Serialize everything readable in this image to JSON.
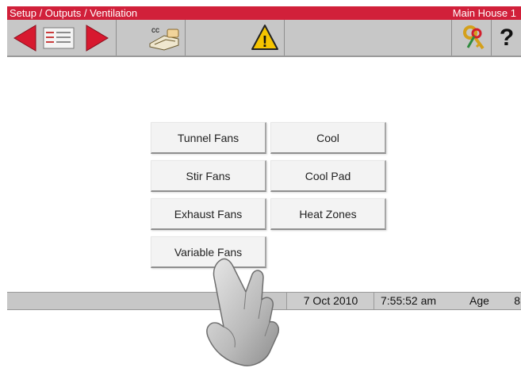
{
  "titlebar": {
    "breadcrumb": "Setup / Outputs / Ventilation",
    "house": "Main House 1"
  },
  "toolbar": {
    "icons": [
      "back-arrow-icon",
      "menu-list-icon",
      "forward-arrow-icon",
      "cc-hand-icon",
      "warning-icon",
      "keys-icon",
      "help-icon"
    ],
    "cc_text": "cc",
    "help_text": "?",
    "warning_text": "!"
  },
  "menu": {
    "tunnel_fans": "Tunnel Fans",
    "cool": "Cool",
    "stir_fans": "Stir Fans",
    "cool_pad": "Cool Pad",
    "exhaust_fans": "Exhaust Fans",
    "heat_zones": "Heat Zones",
    "variable_fans": "Variable Fans"
  },
  "status": {
    "date": "7 Oct 2010",
    "time": "7:55:52 am",
    "age_label": "Age",
    "age_value": "8"
  },
  "colors": {
    "title_red": "#d1203a",
    "toolbar_gray": "#c7c7c7",
    "warning_yellow": "#f5c400"
  }
}
